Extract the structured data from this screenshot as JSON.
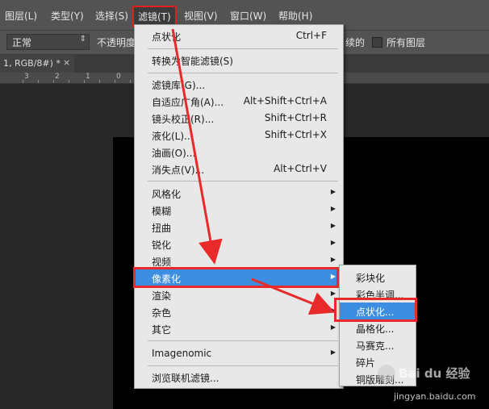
{
  "menubar": {
    "items": [
      "图层(L)",
      "类型(Y)",
      "选择(S)",
      "滤镜(T)",
      "视图(V)",
      "窗口(W)",
      "帮助(H)"
    ]
  },
  "options": {
    "mode": "正常",
    "opacity_label": "不透明度",
    "adjacent_fragment": "续的",
    "all_layers": "所有图层"
  },
  "doc_tab": {
    "title": "1, RGB/8#) *",
    "close": "×"
  },
  "ruler": {
    "marks": [
      "3",
      "2",
      "1",
      "0"
    ]
  },
  "filter_menu": {
    "items": [
      {
        "label": "点状化",
        "shortcut": "Ctrl+F"
      },
      {
        "label": "转换为智能滤镜(S)",
        "shortcut": ""
      },
      {
        "label": "滤镜库(G)...",
        "shortcut": ""
      },
      {
        "label": "自适应广角(A)...",
        "shortcut": "Alt+Shift+Ctrl+A"
      },
      {
        "label": "镜头校正(R)...",
        "shortcut": "Shift+Ctrl+R"
      },
      {
        "label": "液化(L)...",
        "shortcut": "Shift+Ctrl+X"
      },
      {
        "label": "油画(O)...",
        "shortcut": ""
      },
      {
        "label": "消失点(V)...",
        "shortcut": "Alt+Ctrl+V"
      },
      {
        "label": "风格化",
        "shortcut": ""
      },
      {
        "label": "模糊",
        "shortcut": ""
      },
      {
        "label": "扭曲",
        "shortcut": ""
      },
      {
        "label": "锐化",
        "shortcut": ""
      },
      {
        "label": "视频",
        "shortcut": ""
      },
      {
        "label": "像素化",
        "shortcut": ""
      },
      {
        "label": "渲染",
        "shortcut": ""
      },
      {
        "label": "杂色",
        "shortcut": ""
      },
      {
        "label": "其它",
        "shortcut": ""
      },
      {
        "label": "Imagenomic",
        "shortcut": ""
      },
      {
        "label": "浏览联机滤镜...",
        "shortcut": ""
      }
    ],
    "submenu_arrow": "▶"
  },
  "pixelate_submenu": {
    "items": [
      "彩块化",
      "彩色半调...",
      "点状化...",
      "晶格化...",
      "马赛克...",
      "碎片",
      "铜版雕刻..."
    ]
  },
  "watermark": {
    "brand": "Bai du 经验",
    "url": "jingyan.baidu.com"
  },
  "colors": {
    "highlight": "#3d8ee0",
    "annotation_red": "#e82a2a"
  }
}
